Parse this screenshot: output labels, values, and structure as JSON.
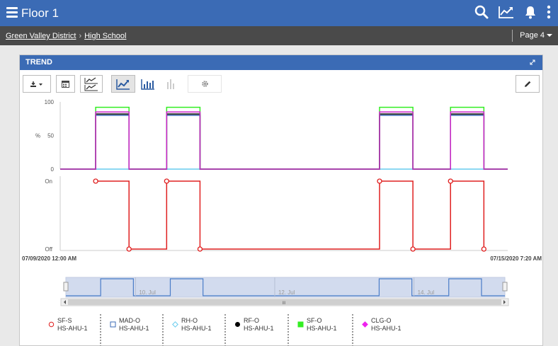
{
  "app": {
    "title": "Floor 1"
  },
  "breadcrumb": {
    "items": [
      "Green Valley District",
      "High School"
    ],
    "separator": "›"
  },
  "page_selector": {
    "label": "Page 4"
  },
  "panel": {
    "title": "TREND"
  },
  "icons": {
    "menu": "hamburger-icon",
    "search": "search-icon",
    "trend": "trend-icon",
    "notifications": "bell-icon",
    "more": "more-vertical-icon",
    "expand": "expand-icon",
    "download": "download-icon",
    "calendar": "calendar-icon",
    "compare": "compare-icon",
    "line": "line-chart-icon",
    "bar": "bar-chart-icon",
    "column": "column-chart-icon",
    "settings": "gear-icon",
    "edit": "pencil-icon"
  },
  "colors": {
    "header": "#3b6bb5",
    "breadcrumb_bar": "#4a4a4a"
  },
  "chart_data": {
    "type": "line",
    "x_start_label": "07/09/2020 12:00 AM",
    "x_end_label": "07/15/2020 7:20 AM",
    "analog": {
      "ylabel": "%",
      "ylim": [
        0,
        100
      ],
      "yticks": [
        "100",
        "50",
        "0"
      ],
      "series": [
        {
          "name": "MAD-O",
          "color": "#3b6bb5",
          "on_value": 80,
          "off_value": 0
        },
        {
          "name": "RH-O",
          "color": "#66ccee",
          "on_value": 0,
          "off_value": 0
        },
        {
          "name": "RF-O",
          "color": "#000000",
          "on_value": 82,
          "off_value": 0
        },
        {
          "name": "SF-O",
          "color": "#33ee22",
          "on_value": 92,
          "off_value": 0
        },
        {
          "name": "CLG-O",
          "color": "#cc22cc",
          "on_value": 85,
          "off_value": 0
        }
      ]
    },
    "digital": {
      "ylabels": [
        "On",
        "Off"
      ],
      "series": {
        "name": "SF-S",
        "color": "#e02020"
      }
    },
    "on_periods_days": [
      [
        0.5,
        0.97
      ],
      [
        1.5,
        1.97
      ],
      [
        4.5,
        4.97
      ],
      [
        5.5,
        5.97
      ]
    ],
    "x_range_days": [
      0,
      6.306
    ],
    "navigator": {
      "labels": [
        "10. Jul",
        "12. Jul",
        "14. Jul"
      ]
    }
  },
  "legend": [
    {
      "point": "SF-S",
      "equip": "HS-AHU-1",
      "color": "#e02020",
      "marker": "circle-open"
    },
    {
      "point": "MAD-O",
      "equip": "HS-AHU-1",
      "color": "#3b6bb5",
      "marker": "square-open"
    },
    {
      "point": "RH-O",
      "equip": "HS-AHU-1",
      "color": "#66ccee",
      "marker": "diamond-open"
    },
    {
      "point": "RF-O",
      "equip": "HS-AHU-1",
      "color": "#000000",
      "marker": "circle"
    },
    {
      "point": "SF-O",
      "equip": "HS-AHU-1",
      "color": "#33ee22",
      "marker": "square"
    },
    {
      "point": "CLG-O",
      "equip": "HS-AHU-1",
      "color": "#ee22ee",
      "marker": "diamond"
    }
  ]
}
